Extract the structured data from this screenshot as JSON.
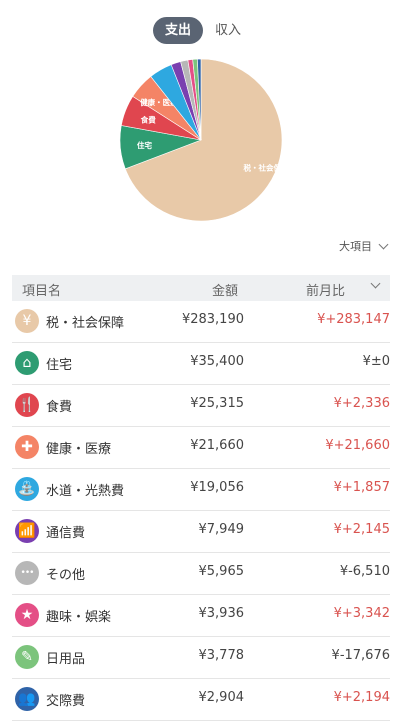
{
  "tabs": {
    "expense": "支出",
    "income": "収入"
  },
  "level_select": "大項目",
  "table": {
    "col_name": "項目名",
    "col_amount": "金額",
    "col_prev": "前月比"
  },
  "rows": [
    {
      "name": "税・社会保障",
      "amount": "¥283,190",
      "diff": "¥+283,147",
      "up": true,
      "color": "#e8c9a8",
      "icon": "coins-icon",
      "glyph": "¥"
    },
    {
      "name": "住宅",
      "amount": "¥35,400",
      "diff": "¥±0",
      "up": false,
      "color": "#2e9c72",
      "icon": "house-icon",
      "glyph": "⌂"
    },
    {
      "name": "食費",
      "amount": "¥25,315",
      "diff": "¥+2,336",
      "up": true,
      "color": "#e0464f",
      "icon": "fork-knife-icon",
      "glyph": "🍴"
    },
    {
      "name": "健康・医療",
      "amount": "¥21,660",
      "diff": "¥+21,660",
      "up": true,
      "color": "#f48466",
      "icon": "medical-cross-icon",
      "glyph": "✚"
    },
    {
      "name": "水道・光熱費",
      "amount": "¥19,056",
      "diff": "¥+1,857",
      "up": true,
      "color": "#2ea8e0",
      "icon": "faucet-icon",
      "glyph": "⛲"
    },
    {
      "name": "通信費",
      "amount": "¥7,949",
      "diff": "¥+2,145",
      "up": true,
      "color": "#7a3fb0",
      "icon": "antenna-icon",
      "glyph": "📶"
    },
    {
      "name": "その他",
      "amount": "¥5,965",
      "diff": "¥-6,510",
      "up": false,
      "color": "#b7b7b7",
      "icon": "more-dots-icon",
      "glyph": "•••"
    },
    {
      "name": "趣味・娯楽",
      "amount": "¥3,936",
      "diff": "¥+3,342",
      "up": true,
      "color": "#e44f86",
      "icon": "star-icon",
      "glyph": "★"
    },
    {
      "name": "日用品",
      "amount": "¥3,778",
      "diff": "¥-17,676",
      "up": false,
      "color": "#7cc47c",
      "icon": "toothbrush-icon",
      "glyph": "✎"
    },
    {
      "name": "交際費",
      "amount": "¥2,904",
      "diff": "¥+2,194",
      "up": true,
      "color": "#2f63a8",
      "icon": "people-icon",
      "glyph": "👥"
    }
  ],
  "chart_data": {
    "type": "pie",
    "labels": [
      "税・社会保障",
      "住宅",
      "食費",
      "健康・医療",
      "水道・光熱費",
      "通信費",
      "その他",
      "趣味・娯楽",
      "日用品",
      "交際費"
    ],
    "values": [
      283190,
      35400,
      25315,
      21660,
      19056,
      7949,
      5965,
      3936,
      3778,
      2904
    ],
    "colors": [
      "#e8c9a8",
      "#2e9c72",
      "#e0464f",
      "#f48466",
      "#2ea8e0",
      "#7a3fb0",
      "#b7b7b7",
      "#e44f86",
      "#7cc47c",
      "#2f63a8"
    ],
    "slice_labels": [
      "税・社会保障",
      "住宅",
      "食費",
      "健康・医療"
    ]
  }
}
